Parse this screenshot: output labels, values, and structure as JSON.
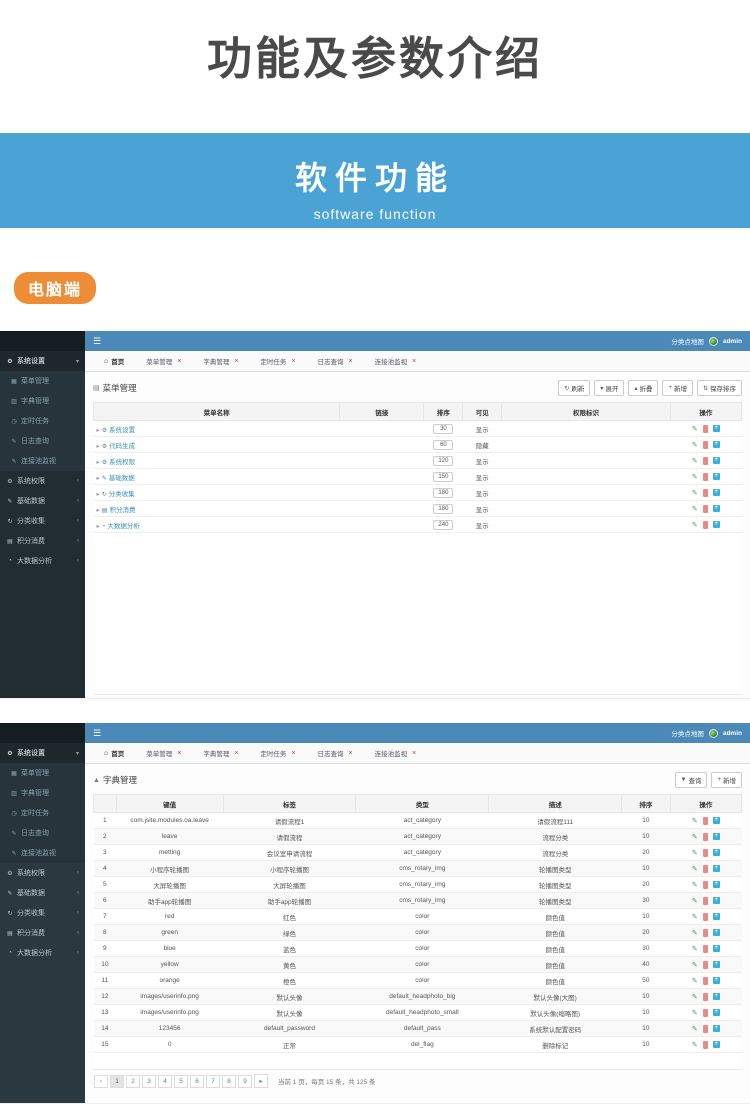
{
  "page": {
    "title": "功能及参数介绍",
    "banner": {
      "title": "软件功能",
      "subtitle": "software function",
      "bg": "#4ba3d5"
    },
    "badge": "电脑端",
    "badge_color": "#ee8d35"
  },
  "colors": {
    "topbar_blue": "#4a89b8",
    "sidebar_dark": "#222d32",
    "link_blue": "#3c8dbc",
    "edit_green": "#4ca64c",
    "delete_red": "#e78c85",
    "add_blue": "#3bafda"
  },
  "icon_glyphs": {
    "hamburger": "☰",
    "home": "⌂",
    "caret-down": "▾",
    "caret-up": "▴",
    "caret-left": "‹",
    "caret-right": "▸",
    "refresh": "↻",
    "plus": "+",
    "sort": "⇅",
    "filter": "▼",
    "edit": "✎",
    "wrench": "⚙",
    "gear": "⚙",
    "table": "▦",
    "dict": "▥",
    "clock": "◷",
    "log": "✎",
    "link": "✎",
    "retweet": "↻",
    "card": "▤",
    "chart": "◔",
    "list": "▤",
    "sitemap": "▲",
    "close": "×"
  },
  "admin": {
    "topbar": {
      "menu_link": "分类点地图",
      "user": "admin"
    },
    "sidebar": {
      "groups": [
        {
          "label": "系统设置",
          "icon": "wrench",
          "state": "expanded",
          "children": [
            {
              "label": "菜单管理",
              "icon": "table"
            },
            {
              "label": "字典管理",
              "icon": "dict"
            },
            {
              "label": "定时任务",
              "icon": "clock"
            },
            {
              "label": "日志查询",
              "icon": "log"
            },
            {
              "label": "连接池监视",
              "icon": "link"
            }
          ]
        },
        {
          "label": "系统权限",
          "icon": "gear",
          "state": "collapsed"
        },
        {
          "label": "基础数据",
          "icon": "edit",
          "state": "collapsed"
        },
        {
          "label": "分类收集",
          "icon": "retweet",
          "state": "collapsed"
        },
        {
          "label": "积分消费",
          "icon": "card",
          "state": "collapsed"
        },
        {
          "label": "大数据分析",
          "icon": "chart",
          "state": "collapsed"
        }
      ]
    },
    "tabs": [
      {
        "label": "首页",
        "icon": "home",
        "closable": false
      },
      {
        "label": "菜单管理",
        "closable": true
      },
      {
        "label": "字典管理",
        "closable": true
      },
      {
        "label": "定时任务",
        "closable": true
      },
      {
        "label": "日志查询",
        "closable": true
      },
      {
        "label": "连接池监视",
        "closable": true
      }
    ]
  },
  "shot1": {
    "page_title": "菜单管理",
    "page_icon": "list",
    "toolbar": [
      {
        "name": "refresh",
        "icon": "refresh",
        "label": "刷新"
      },
      {
        "name": "expand",
        "icon": "caret-down",
        "label": "展开"
      },
      {
        "name": "collapse",
        "icon": "caret-up",
        "label": "折叠"
      },
      {
        "name": "add",
        "icon": "plus",
        "label": "新增"
      },
      {
        "name": "save-sort",
        "icon": "sort",
        "label": "保存排序"
      }
    ],
    "table": {
      "headers": [
        "菜单名称",
        "链接",
        "排序",
        "可见",
        "权限标识",
        "操作"
      ],
      "rows": [
        {
          "icon": "wrench",
          "name": "系统设置",
          "link": "",
          "sort": "30",
          "visible": "显示",
          "perm": ""
        },
        {
          "icon": "wrench",
          "name": "代码生成",
          "link": "",
          "sort": "60",
          "visible": "隐藏",
          "perm": ""
        },
        {
          "icon": "gear",
          "name": "系统权限",
          "link": "",
          "sort": "120",
          "visible": "显示",
          "perm": ""
        },
        {
          "icon": "edit",
          "name": "基础数据",
          "link": "",
          "sort": "150",
          "visible": "显示",
          "perm": ""
        },
        {
          "icon": "retweet",
          "name": "分类收集",
          "link": "",
          "sort": "180",
          "visible": "显示",
          "perm": ""
        },
        {
          "icon": "card",
          "name": "积分消费",
          "link": "",
          "sort": "180",
          "visible": "显示",
          "perm": ""
        },
        {
          "icon": "chart",
          "name": "大数据分析",
          "link": "",
          "sort": "240",
          "visible": "显示",
          "perm": ""
        }
      ]
    }
  },
  "shot2": {
    "page_title": "字典管理",
    "page_icon": "sitemap",
    "toolbar": [
      {
        "name": "query",
        "icon": "filter",
        "label": "查询"
      },
      {
        "name": "add",
        "icon": "plus",
        "label": "新增"
      }
    ],
    "table": {
      "headers": [
        "",
        "键值",
        "标签",
        "类型",
        "描述",
        "排序",
        "操作"
      ],
      "rows": [
        [
          "1",
          "com.jsite.modules.oa.leave",
          "请假流程1",
          "act_category",
          "请假流程111",
          "10"
        ],
        [
          "2",
          "leave",
          "请假流程",
          "act_category",
          "流程分类",
          "10"
        ],
        [
          "3",
          "metting",
          "会议室申请流程",
          "act_category",
          "流程分类",
          "20"
        ],
        [
          "4",
          "小程序轮播图",
          "小程序轮播图",
          "cms_rotary_img",
          "轮播图类型",
          "10"
        ],
        [
          "5",
          "大屏轮播图",
          "大屏轮播图",
          "cms_rotary_img",
          "轮播图类型",
          "20"
        ],
        [
          "6",
          "助手app轮播图",
          "助手app轮播图",
          "cms_rotary_img",
          "轮播图类型",
          "30"
        ],
        [
          "7",
          "red",
          "红色",
          "color",
          "颜色值",
          "10"
        ],
        [
          "8",
          "green",
          "绿色",
          "color",
          "颜色值",
          "20"
        ],
        [
          "9",
          "blue",
          "蓝色",
          "color",
          "颜色值",
          "30"
        ],
        [
          "10",
          "yellow",
          "黄色",
          "color",
          "颜色值",
          "40"
        ],
        [
          "11",
          "orange",
          "橙色",
          "color",
          "颜色值",
          "50"
        ],
        [
          "12",
          "images/userinfo.png",
          "默认头像",
          "default_headphoto_big",
          "默认头像(大图)",
          "10"
        ],
        [
          "13",
          "images/userinfo.png",
          "默认头像",
          "default_headphoto_small",
          "默认头像(缩略图)",
          "10"
        ],
        [
          "14",
          "123456",
          "default_password",
          "default_pass",
          "系统默认配置密码",
          "10"
        ],
        [
          "15",
          "0",
          "正常",
          "del_flag",
          "删除标记",
          "10"
        ]
      ]
    },
    "pagination": {
      "pages": [
        "1",
        "2",
        "3",
        "4",
        "5",
        "6",
        "7",
        "8",
        "9"
      ],
      "current": "1",
      "info": "当前 1 页，每页 15 条，共 125 条"
    }
  }
}
